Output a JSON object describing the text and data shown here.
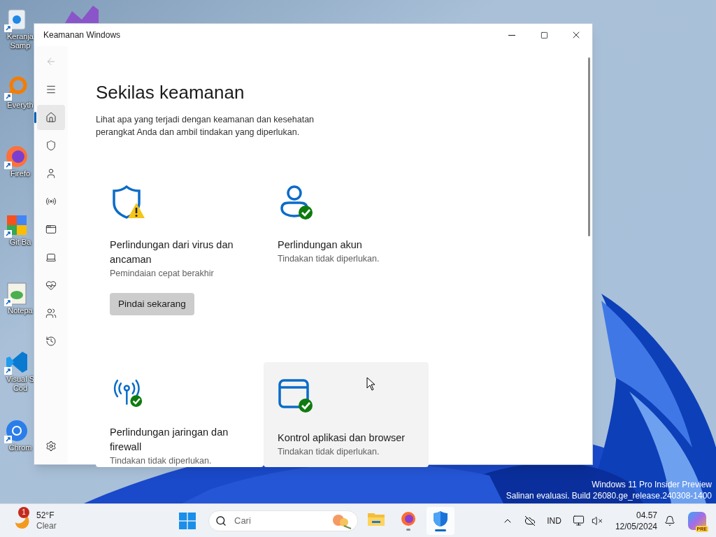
{
  "desktop_icons": [
    {
      "kind": "recycle",
      "label": "Keranja\nSamp"
    },
    {
      "kind": "search",
      "label": "Everyth"
    },
    {
      "kind": "firefox",
      "label": "Firefo"
    },
    {
      "kind": "git",
      "label": "Git Ba"
    },
    {
      "kind": "notepad",
      "label": "Notepa"
    },
    {
      "kind": "vscode",
      "label": "Visual S\nCod"
    },
    {
      "kind": "chrome",
      "label": "Chrom"
    }
  ],
  "window": {
    "title": "Keamanan Windows",
    "nav": [
      {
        "kind": "back",
        "disabled": true,
        "selected": false
      },
      {
        "kind": "menu",
        "disabled": false,
        "selected": false
      },
      {
        "kind": "home",
        "disabled": false,
        "selected": true
      },
      {
        "kind": "shield",
        "disabled": false,
        "selected": false
      },
      {
        "kind": "person",
        "disabled": false,
        "selected": false
      },
      {
        "kind": "antenna",
        "disabled": false,
        "selected": false
      },
      {
        "kind": "app",
        "disabled": false,
        "selected": false
      },
      {
        "kind": "laptop",
        "disabled": false,
        "selected": false
      },
      {
        "kind": "health",
        "disabled": false,
        "selected": false
      },
      {
        "kind": "family",
        "disabled": false,
        "selected": false
      },
      {
        "kind": "history",
        "disabled": false,
        "selected": false
      }
    ],
    "heading": "Sekilas keamanan",
    "description": "Lihat apa yang terjadi dengan keamanan dan kesehatan perangkat Anda dan ambil tindakan yang diperlukan.",
    "cards": [
      {
        "kind": "shield",
        "warning": true,
        "title": "Perlindungan dari virus dan ancaman",
        "subtitle": "Pemindaian cepat berakhir",
        "button": "Pindai sekarang",
        "highlighted": false
      },
      {
        "kind": "person",
        "warning": false,
        "title": "Perlindungan akun",
        "subtitle": "Tindakan tidak diperlukan.",
        "highlighted": false
      },
      {
        "kind": "antenna",
        "warning": false,
        "title": "Perlindungan jaringan dan firewall",
        "subtitle": "Tindakan tidak diperlukan.",
        "highlighted": false
      },
      {
        "kind": "app",
        "warning": false,
        "title": "Kontrol aplikasi dan browser",
        "subtitle": "Tindakan tidak diperlukan.",
        "highlighted": true
      }
    ]
  },
  "watermark": [
    "Windows 11 Pro Insider Preview",
    "Salinan evaluasi. Build 26080.ge_release.240308-1400"
  ],
  "taskbar": {
    "weather": {
      "badge": "1",
      "temperature": "52°F",
      "condition": "Clear"
    },
    "search": {
      "placeholder": "Cari"
    },
    "apps": [
      {
        "kind": "explorer",
        "running": false,
        "selected": false
      },
      {
        "kind": "firefox",
        "running": true,
        "selected": false
      },
      {
        "kind": "security",
        "running": true,
        "selected": true
      }
    ],
    "language": "IND",
    "time": "04.57",
    "date": "12/05/2024",
    "copilot_badge": "PRE"
  }
}
